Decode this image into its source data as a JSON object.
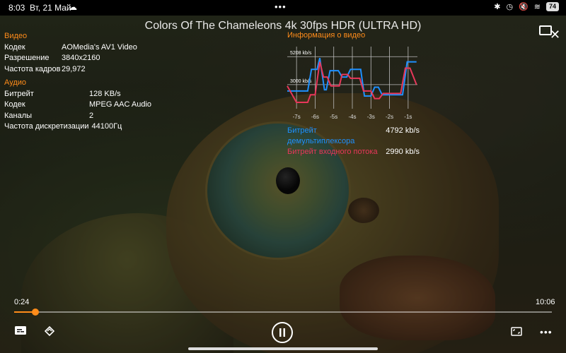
{
  "status_bar": {
    "time": "8:03",
    "date": "Вт, 21 Май",
    "battery": "74"
  },
  "player": {
    "title": "Colors Of The Chameleons 4k 30fps HDR (ULTRA HD)"
  },
  "info": {
    "video_section": "Видео",
    "video_rows": [
      {
        "label": "Кодек",
        "value": "AOMedia's AV1 Video"
      },
      {
        "label": "Разрешение",
        "value": "3840x2160"
      },
      {
        "label": "Частота кадров",
        "value": "29,972"
      }
    ],
    "audio_section": "Аудио",
    "audio_rows": [
      {
        "label": "Битрейт",
        "value": "128 KB/s"
      },
      {
        "label": "Кодек",
        "value": "MPEG AAC Audio"
      },
      {
        "label": "Каналы",
        "value": "2"
      },
      {
        "label": "Частота дискретизации",
        "value": "44100Гц"
      }
    ]
  },
  "stats": {
    "title": "Информация о видео",
    "legend": [
      {
        "label": "Битрейт демультиплексора",
        "value": "4792 kb/s",
        "color": "#1e90ff"
      },
      {
        "label": "Битрейт входного потока",
        "value": "2990 kb/s",
        "color": "#e8375a"
      }
    ]
  },
  "chart_data": {
    "type": "line",
    "y_tick_labels": [
      "5208 kb/s",
      "3000 kb/s"
    ],
    "y_ticks": [
      5208,
      3000
    ],
    "x_tick_labels": [
      "-7s",
      "-6s",
      "-5s",
      "-4s",
      "-3s",
      "-2s",
      "-1s"
    ],
    "xlim": [
      -7.5,
      -0.5
    ],
    "ylim": [
      1100,
      6000
    ],
    "series": [
      {
        "name": "Битрейт демультиплексора",
        "color": "#1e90ff",
        "points": [
          [
            -7.5,
            2500
          ],
          [
            -7.0,
            2500
          ],
          [
            -6.4,
            2500
          ],
          [
            -6.2,
            4200
          ],
          [
            -5.9,
            4200
          ],
          [
            -5.75,
            5100
          ],
          [
            -5.5,
            2600
          ],
          [
            -5.4,
            2600
          ],
          [
            -5.2,
            4100
          ],
          [
            -4.75,
            4100
          ],
          [
            -4.55,
            3600
          ],
          [
            -4.3,
            3600
          ],
          [
            -4.1,
            4200
          ],
          [
            -3.55,
            4200
          ],
          [
            -3.35,
            2100
          ],
          [
            -3.0,
            2100
          ],
          [
            -2.8,
            2800
          ],
          [
            -2.6,
            2800
          ],
          [
            -2.4,
            2200
          ],
          [
            -1.3,
            2200
          ],
          [
            -1.05,
            4800
          ],
          [
            -0.55,
            4800
          ]
        ]
      },
      {
        "name": "Битрейт входного потока",
        "color": "#e8375a",
        "points": [
          [
            -7.5,
            2900
          ],
          [
            -7.0,
            1600
          ],
          [
            -6.4,
            1600
          ],
          [
            -6.25,
            2200
          ],
          [
            -6.0,
            2200
          ],
          [
            -5.75,
            4800
          ],
          [
            -5.55,
            3600
          ],
          [
            -5.35,
            3600
          ],
          [
            -5.15,
            2900
          ],
          [
            -4.7,
            2900
          ],
          [
            -4.55,
            3800
          ],
          [
            -4.25,
            3800
          ],
          [
            -4.1,
            3500
          ],
          [
            -3.6,
            3500
          ],
          [
            -3.4,
            2500
          ],
          [
            -3.0,
            2500
          ],
          [
            -2.8,
            1900
          ],
          [
            -2.55,
            1900
          ],
          [
            -2.35,
            2300
          ],
          [
            -1.4,
            2300
          ],
          [
            -1.15,
            4300
          ],
          [
            -0.9,
            4300
          ],
          [
            -0.55,
            3000
          ]
        ]
      }
    ]
  },
  "controls": {
    "position": "0:24",
    "duration": "10:06",
    "progress_fraction": 0.04
  }
}
